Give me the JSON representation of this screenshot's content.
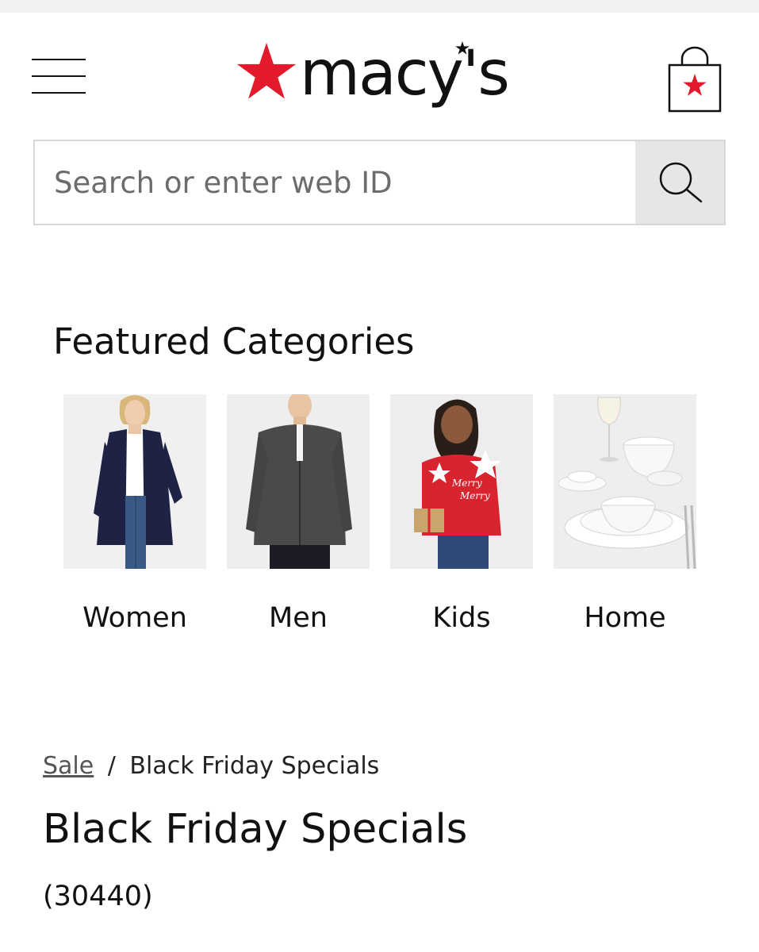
{
  "header": {
    "logo_text": "macy's"
  },
  "search": {
    "placeholder": "Search or enter web ID",
    "value": ""
  },
  "featured": {
    "title": "Featured Categories",
    "categories": [
      {
        "label": "Women"
      },
      {
        "label": "Men"
      },
      {
        "label": "Kids"
      },
      {
        "label": "Home"
      }
    ]
  },
  "breadcrumb": {
    "parent": "Sale",
    "separator": "/",
    "current": "Black Friday Specials"
  },
  "listing": {
    "title": "Black Friday Specials",
    "count": "(30440)"
  },
  "colors": {
    "brand_red": "#e21a2c",
    "search_button_bg": "#e6e6e6"
  },
  "icons": [
    "menu-icon",
    "macys-star-icon",
    "shopping-bag-icon",
    "search-icon"
  ]
}
